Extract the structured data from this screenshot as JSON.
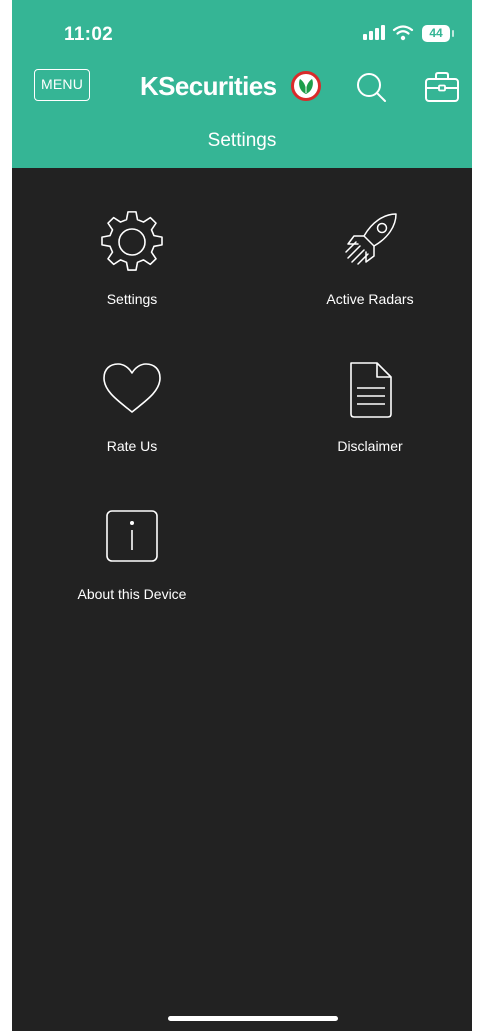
{
  "status_bar": {
    "time": "11:02",
    "battery": "44"
  },
  "header": {
    "menu_label": "MENU",
    "brand": "KSecurities",
    "title": "Settings"
  },
  "items": [
    {
      "label": "Settings",
      "icon": "gear-icon"
    },
    {
      "label": "Active Radars",
      "icon": "rocket-icon"
    },
    {
      "label": "Rate Us",
      "icon": "heart-icon"
    },
    {
      "label": "Disclaimer",
      "icon": "document-icon"
    },
    {
      "label": "About this Device",
      "icon": "info-icon"
    }
  ],
  "colors": {
    "accent": "#35b595",
    "background": "#222222",
    "logo_ring": "#d92b2b"
  }
}
